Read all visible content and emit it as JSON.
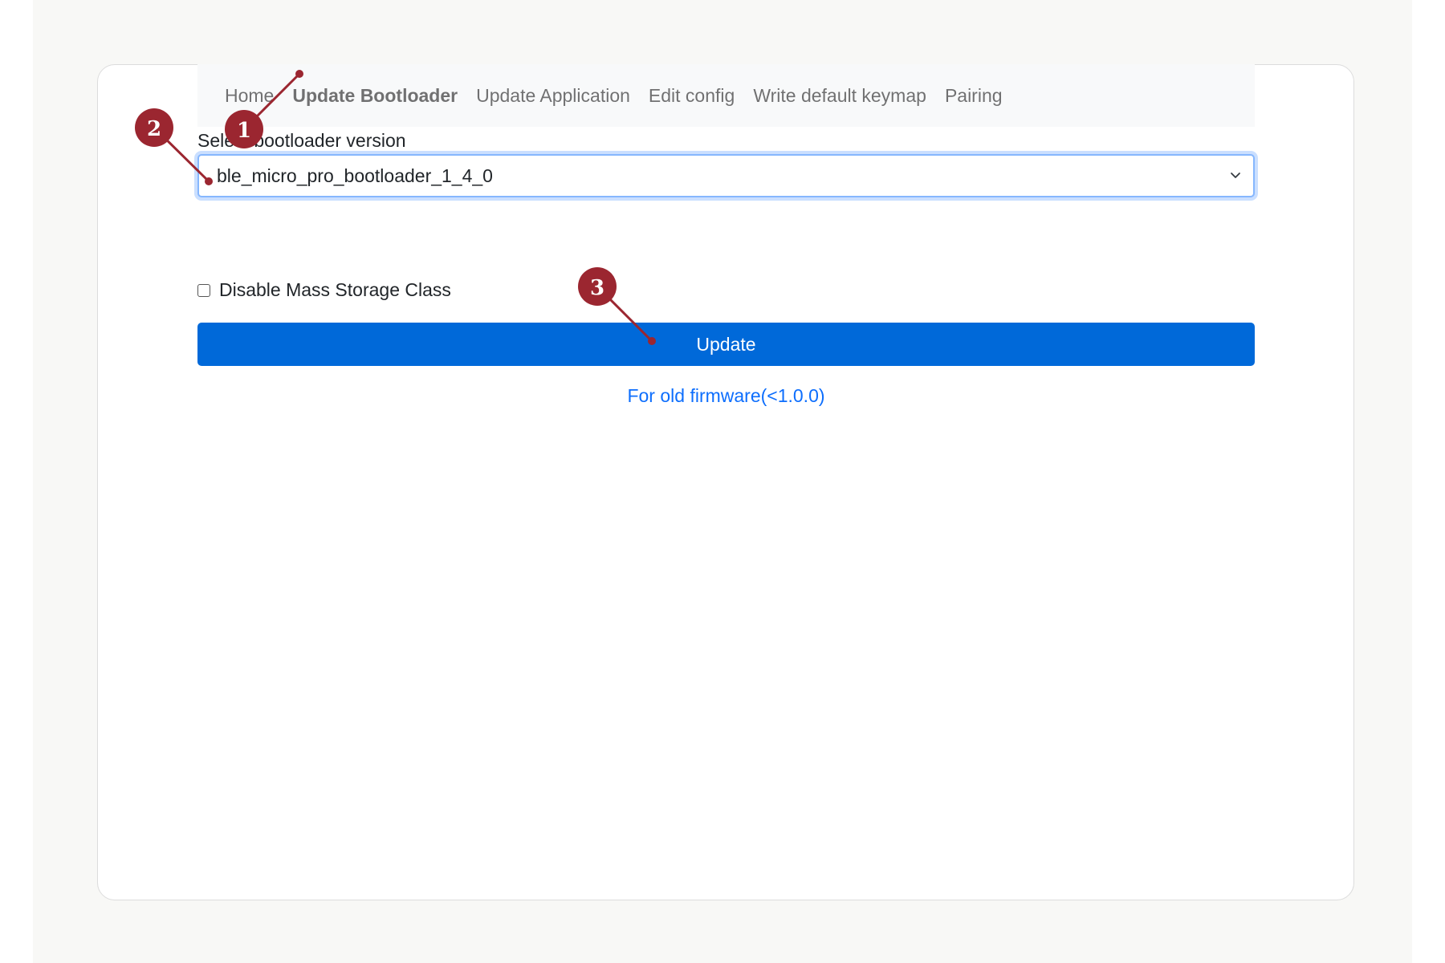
{
  "nav": {
    "items": [
      {
        "label": "Home"
      },
      {
        "label": "Update Bootloader",
        "active": true
      },
      {
        "label": "Update Application"
      },
      {
        "label": "Edit config"
      },
      {
        "label": "Write default keymap"
      },
      {
        "label": "Pairing"
      }
    ]
  },
  "form": {
    "select_label": "Select bootloader version",
    "select_value": "ble_micro_pro_bootloader_1_4_0",
    "checkbox_label": "Disable Mass Storage Class",
    "update_label": "Update",
    "old_firmware_link": "For old firmware(<1.0.0)"
  },
  "annotations": {
    "markers": [
      "1",
      "2",
      "3"
    ],
    "color": "#9b2630"
  },
  "colors": {
    "primary_button": "#0069d9",
    "link": "#0d6efd",
    "focus_border": "#86b7fe"
  }
}
